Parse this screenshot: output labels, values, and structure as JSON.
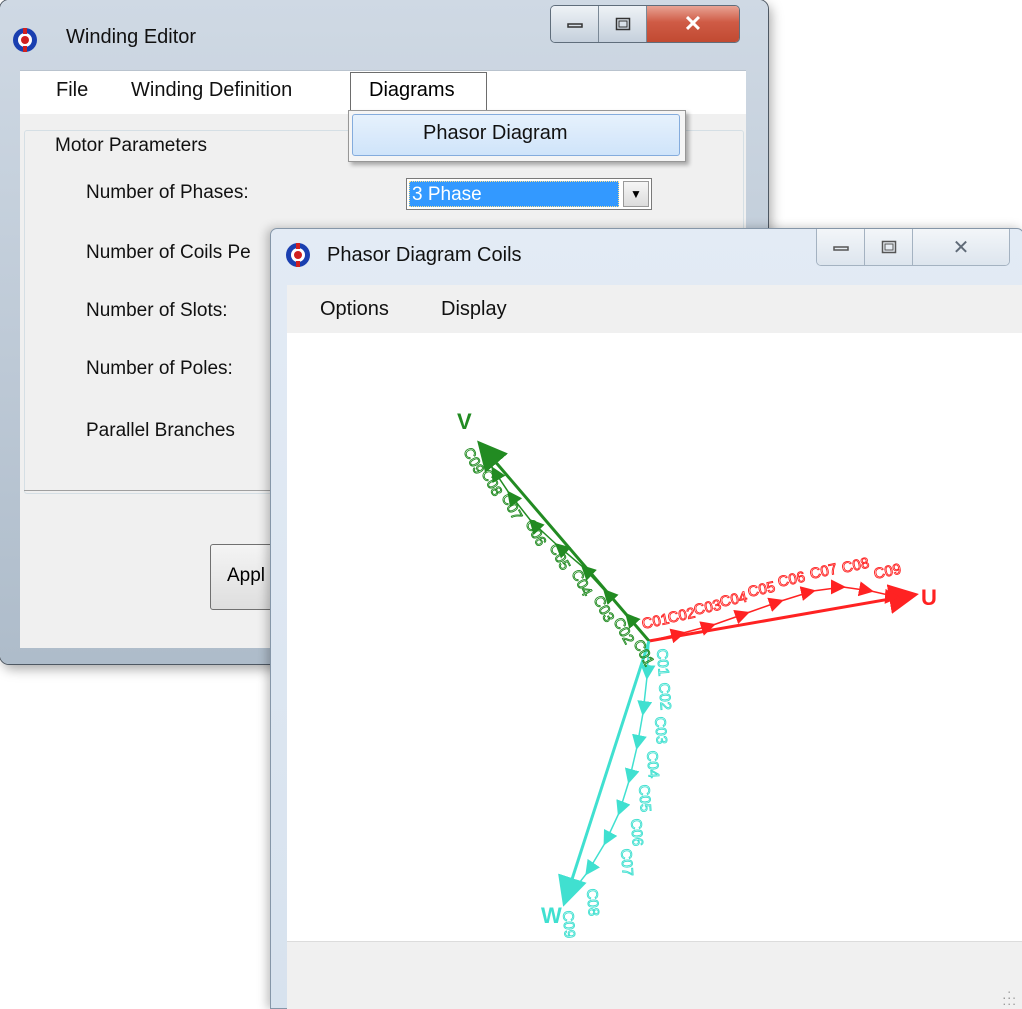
{
  "back_window": {
    "title": "Winding Editor",
    "menu": [
      "File",
      "Winding Definition",
      "Diagrams"
    ],
    "dropdown_item": "Phasor Diagram",
    "group_title": "Motor Parameters",
    "fields": [
      "Number of Phases:",
      "Number of Coils Pe",
      "Number of Slots:",
      "Number of Poles:",
      "Parallel Branches"
    ],
    "phases_value": "3 Phase",
    "apply_label": "Appl"
  },
  "front_window": {
    "title": "Phasor Diagram Coils",
    "menu": [
      "Options",
      "Display"
    ]
  },
  "phasor": {
    "phase_labels": [
      "U",
      "V",
      "W"
    ],
    "colors": {
      "U": "#ff2222",
      "V": "#228b22",
      "W": "#40e0d0"
    },
    "coil_labels": {
      "U": [
        "C01",
        "C02",
        "C03",
        "C04",
        "C05",
        "C06",
        "C07",
        "C08",
        "C09"
      ],
      "V": [
        "C01",
        "C02",
        "C03",
        "C04",
        "C05",
        "C06",
        "C07",
        "C08",
        "C09"
      ],
      "W": [
        "C01",
        "C02",
        "C03",
        "C04",
        "C05",
        "C06",
        "C07",
        "C08",
        "C09"
      ]
    }
  }
}
